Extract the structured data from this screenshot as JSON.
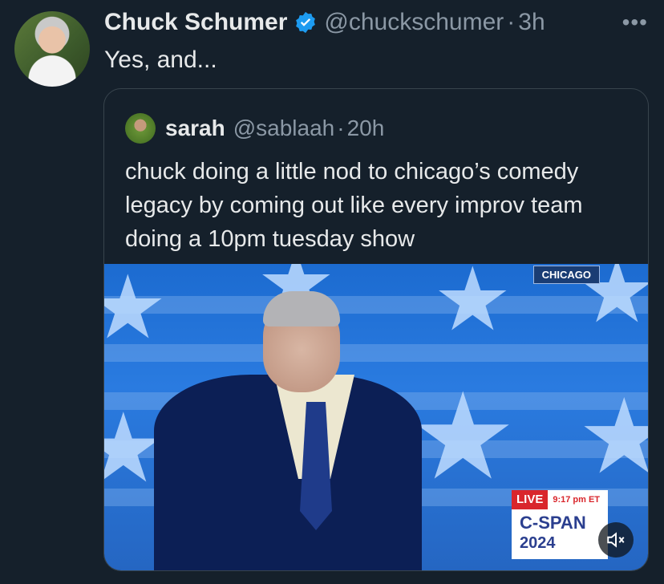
{
  "tweet": {
    "author_name": "Chuck Schumer",
    "author_handle": "@chuckschumer",
    "separator": "·",
    "time": "3h",
    "more_label": "•••",
    "text": "Yes, and..."
  },
  "quoted": {
    "author_name": "sarah",
    "author_handle": "@sablaah",
    "separator": "·",
    "time": "20h",
    "text": "chuck doing a little nod to chicago’s comedy legacy by coming out like every improv team doing a 10pm tuesday show"
  },
  "media": {
    "location_tag": "CHICAGO",
    "live_label": "LIVE",
    "live_time": "9:17 pm ET",
    "network": "C-SPAN",
    "year": "2024",
    "mute_icon": "speaker-muted-icon"
  },
  "colors": {
    "background": "#15202b",
    "handle_gray": "#8b98a5",
    "verified_blue": "#1d9bf0",
    "border": "#38444d",
    "live_red": "#d9262c",
    "cspan_blue": "#2b3f8f"
  }
}
